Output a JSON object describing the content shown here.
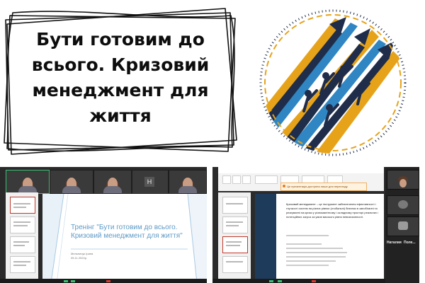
{
  "title": {
    "lines": [
      "Бути готовим до",
      "всього. Кризовий",
      "менеджмент для",
      "життя"
    ]
  },
  "logo": {
    "icon": "arrows-upward-logo",
    "colors": {
      "navy": "#1f2d4a",
      "gold": "#e6a31a",
      "blue": "#2f86c3"
    }
  },
  "left_screenshot": {
    "participant_badge": "H",
    "slide": {
      "title": "Тренінг \"Бути готовим до всього. Кризовий менеджмент для життя\"",
      "author": "Мельничук Ірина",
      "date": "05.11.2024р."
    }
  },
  "right_screenshot": {
    "notification": "Це презентація доступна лише для перегляду",
    "definition": "Кризовий менеджмент – це інструмент забезпечення ефективності і гнучкості систем на різних рівнях (глобальні) безпеки в запобіганні та реагуванні на кризи у різноманітному і складному просторі реальних і потенційних загроз за умов високого рівня невизначеності.",
    "names": [
      "Наталия",
      "Поле..."
    ]
  },
  "colors": {
    "accent_blue": "#5d9ac6",
    "dark_bg": "#2a2a2a"
  }
}
